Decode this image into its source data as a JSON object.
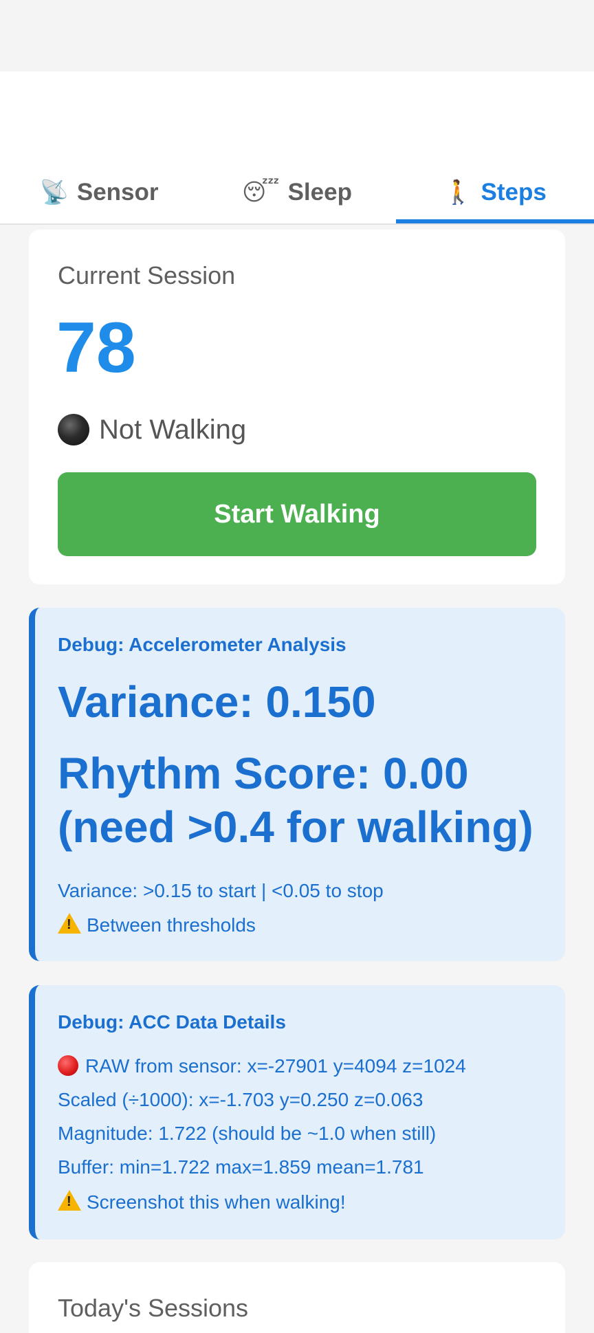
{
  "tabs": [
    {
      "icon": "📡",
      "label": "Sensor",
      "active": false
    },
    {
      "icon": "😴",
      "label": "Sleep",
      "active": false
    },
    {
      "icon": "🚶",
      "label": "Steps",
      "active": true
    }
  ],
  "session": {
    "title": "Current Session",
    "step_count": "78",
    "status": "Not Walking",
    "button_label": "Start Walking"
  },
  "accelerometer_debug": {
    "heading": "Debug: Accelerometer Analysis",
    "variance": "Variance: 0.150",
    "rhythm": "Rhythm Score: 0.00 (need >0.4 for walking)",
    "thresholds": "Variance: >0.15 to start | <0.05 to stop",
    "warning": "Between thresholds"
  },
  "acc_data_debug": {
    "heading": "Debug: ACC Data Details",
    "raw": "RAW from sensor: x=-27901 y=4094 z=1024",
    "scaled": "Scaled (÷1000): x=-1.703 y=0.250 z=0.063",
    "magnitude": "Magnitude: 1.722 (should be ~1.0 when still)",
    "buffer": "Buffer: min=1.722 max=1.859 mean=1.781",
    "warning": "Screenshot this when walking!"
  },
  "today": {
    "title": "Today's Sessions"
  },
  "colors": {
    "accent": "#1a7fe0",
    "start_button": "#4caf50",
    "debug_bg": "#e3effb",
    "debug_text": "#1a6fcf"
  }
}
